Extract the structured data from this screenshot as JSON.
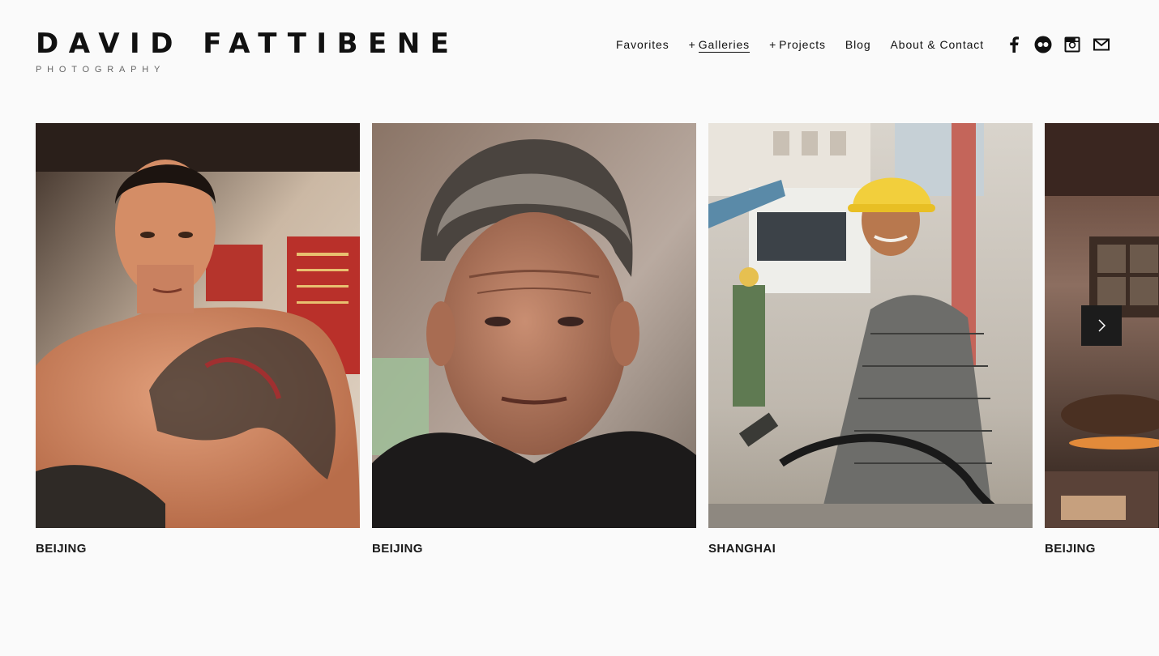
{
  "brand": {
    "title": "DAVID FATTIBENE",
    "subtitle": "PHOTOGRAPHY"
  },
  "nav": {
    "favorites": "Favorites",
    "galleries_prefix": "+",
    "galleries": "Galleries",
    "projects_prefix": "+",
    "projects": "Projects",
    "blog": "Blog",
    "about": "About & Contact"
  },
  "social": [
    "facebook-icon",
    "flickr-icon",
    "instagram-icon",
    "mail-icon"
  ],
  "gallery": {
    "items": [
      {
        "caption": "BEIJING",
        "photo": "portrait-tattooed-man"
      },
      {
        "caption": "BEIJING",
        "photo": "portrait-older-man"
      },
      {
        "caption": "SHANGHAI",
        "photo": "portrait-construction-worker"
      },
      {
        "caption": "BEIJING",
        "photo": "interior-stove"
      }
    ]
  },
  "colors": {
    "background": "#fafafa",
    "text": "#111111",
    "button": "#1c1c1c"
  }
}
